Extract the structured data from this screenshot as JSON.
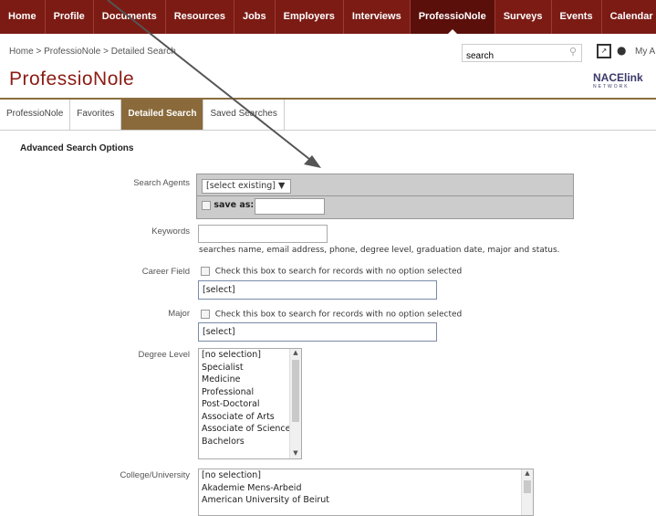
{
  "nav": {
    "items": [
      "Home",
      "Profile",
      "Documents",
      "Resources",
      "Jobs",
      "Employers",
      "Interviews",
      "ProfessioNole",
      "Surveys",
      "Events",
      "Calendar"
    ],
    "active": "ProfessioNole"
  },
  "header": {
    "breadcrumb": "Home > ProfessioNole > Detailed Search",
    "search_value": "search",
    "my_account": "My A",
    "brand": "ProfessioNole",
    "logo_text": "NACElink",
    "logo_sub": "NETWORK"
  },
  "tabs": [
    "ProfessioNole",
    "Favorites",
    "Detailed Search",
    "Saved Searches"
  ],
  "panel": {
    "title": "Advanced Search Options",
    "search_agents_label": "Search Agents",
    "search_agents_select": "[select existing]  ▼",
    "save_as_label": "save as:",
    "keywords_label": "Keywords",
    "keywords_help": "searches name, email address, phone, degree level, graduation date, major and status.",
    "career_field_label": "Career Field",
    "career_field_check": "Check this box to search for records with no option selected",
    "career_field_select": "[select]",
    "major_label": "Major",
    "major_check": "Check this box to search for records with no option selected",
    "major_select": "[select]",
    "degree_level_label": "Degree Level",
    "degree_levels": [
      "[no selection]",
      "Specialist",
      "Medicine",
      "Professional",
      "Post-Doctoral",
      "Associate of Arts",
      "Associate of Science",
      "Bachelors"
    ],
    "college_label": "College/University",
    "colleges": [
      "[no selection]",
      "Akademie Mens-Arbeid",
      "American University of Beirut"
    ]
  },
  "colors": {
    "nav_bg": "#7b1b14",
    "nav_active": "#5a0f0a",
    "tab_active": "#8a6a3b",
    "brand": "#8b1c14"
  }
}
